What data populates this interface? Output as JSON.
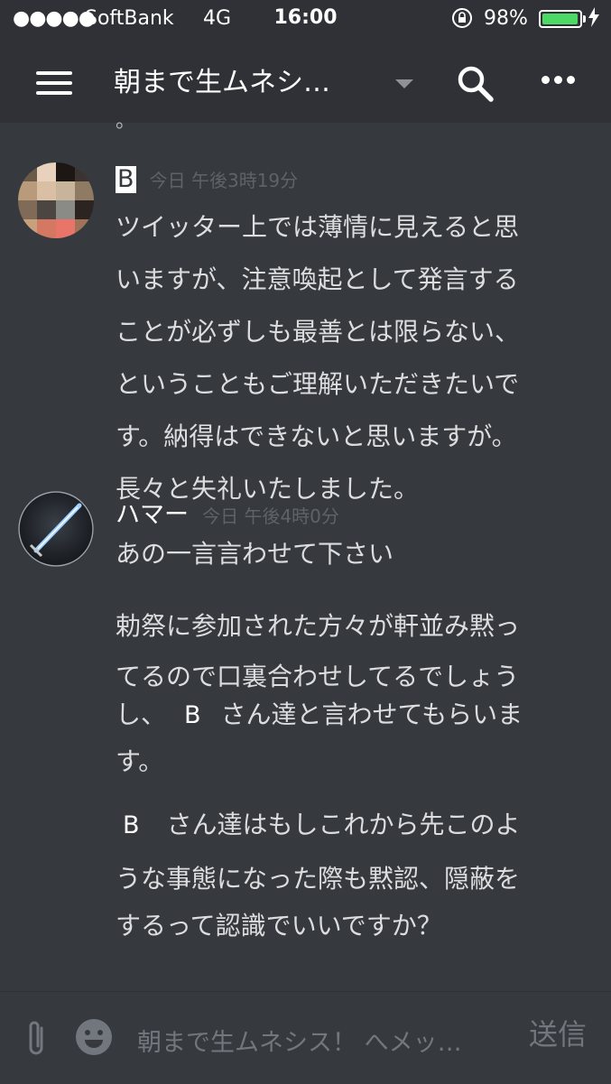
{
  "status_bar": {
    "signal": "●●●●●",
    "carrier": "SoftBank",
    "network": "4G",
    "time": "16:00",
    "battery_percent": "98%",
    "battery_level": 0.98,
    "lock_icon": "rotation-lock-icon",
    "charging_icon": "bolt-icon"
  },
  "header": {
    "title": "朝まで生ムネシ…",
    "menu_icon": "hamburger-icon",
    "dropdown_icon": "caret-down-icon",
    "search_icon": "search-icon",
    "more_icon": "more-icon"
  },
  "cutoff_text": "。",
  "messages": [
    {
      "author": "B",
      "timestamp": "今日 午後3時19分",
      "lines": [
        "ツイッター上では薄情に見えると思",
        "いますが、注意喚起として発言する",
        "ことが必ずしも最善とは限らない、",
        "ということもご理解いただきたいで",
        "す。納得はできないと思いますが。",
        "長々と失礼いたしました。"
      ]
    },
    {
      "author": "ハマー",
      "timestamp": "今日 午後4時0分",
      "lines": [
        "あの一言言わせて下さい",
        "勅祭に参加された方々が軒並み黙っ",
        "てるので口裏合わせしてるでしょう",
        "し、",
        "さん達と言わせてもらいま",
        "す。",
        "さん達はもしこれから先このよ",
        "うな事態になった際も黙認、隠蔽を",
        "するって認識でいいですか？"
      ],
      "redacted_names": [
        "B",
        "B"
      ]
    }
  ],
  "input_bar": {
    "placeholder": "朝まで生ムネシス！ へメッ…",
    "send_label": "送信",
    "attach_icon": "paperclip-icon",
    "emoji_icon": "emoji-icon"
  },
  "colors": {
    "background": "#36393e",
    "header": "#2f3136",
    "text": "#dcddde",
    "timestamp": "#5f6368",
    "battery": "#4cd964"
  }
}
